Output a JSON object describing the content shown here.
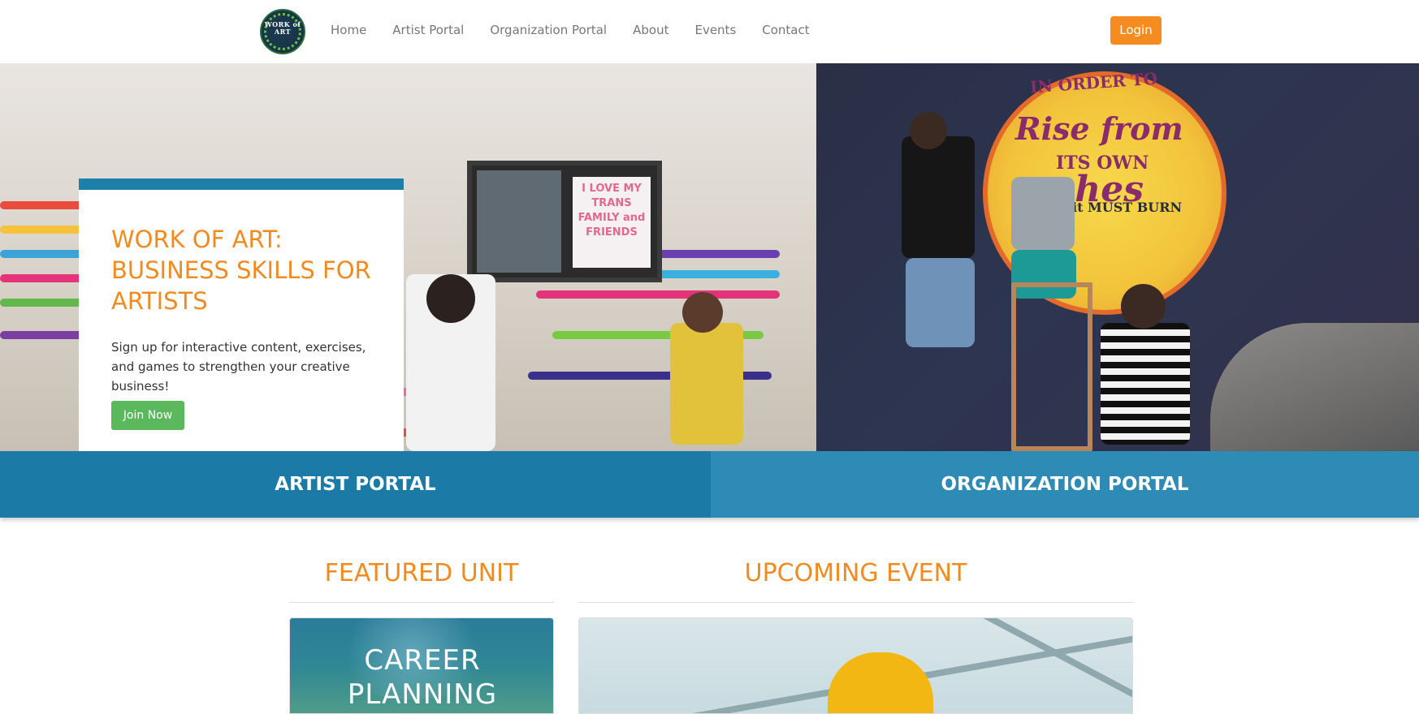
{
  "nav": {
    "logo_text": "WORK of ART",
    "links": [
      "Home",
      "Artist Portal",
      "Organization Portal",
      "About",
      "Events",
      "Contact"
    ],
    "login_label": "Login"
  },
  "hero": {
    "title": "WORK OF ART: BUSINESS SKILLS FOR ARTISTS",
    "description": "Sign up for interactive content, exercises, and games to strengthen your creative business!",
    "join_label": "Join Now",
    "mural_text_1": "IN ORDER TO",
    "mural_text_2": "Rise from",
    "mural_text_3": "ITS OWN",
    "mural_text_4": "ashes",
    "mural_text_5": "it MUST BURN",
    "window_sign": "I LOVE MY TRANS FAMILY and FRIENDS"
  },
  "portals": {
    "artist_label": "ARTIST PORTAL",
    "organization_label": "ORGANIZATION PORTAL"
  },
  "featured": {
    "title": "FEATURED UNIT",
    "card_text_1": "CAREER",
    "card_text_2": "PLANNING"
  },
  "upcoming": {
    "title": "UPCOMING EVENT"
  },
  "colors": {
    "accent_orange": "#f08b22",
    "login_orange": "#f68b1f",
    "join_green": "#5cb85c",
    "artist_blue": "#1b7ba6",
    "org_blue": "#2e8bb5"
  }
}
